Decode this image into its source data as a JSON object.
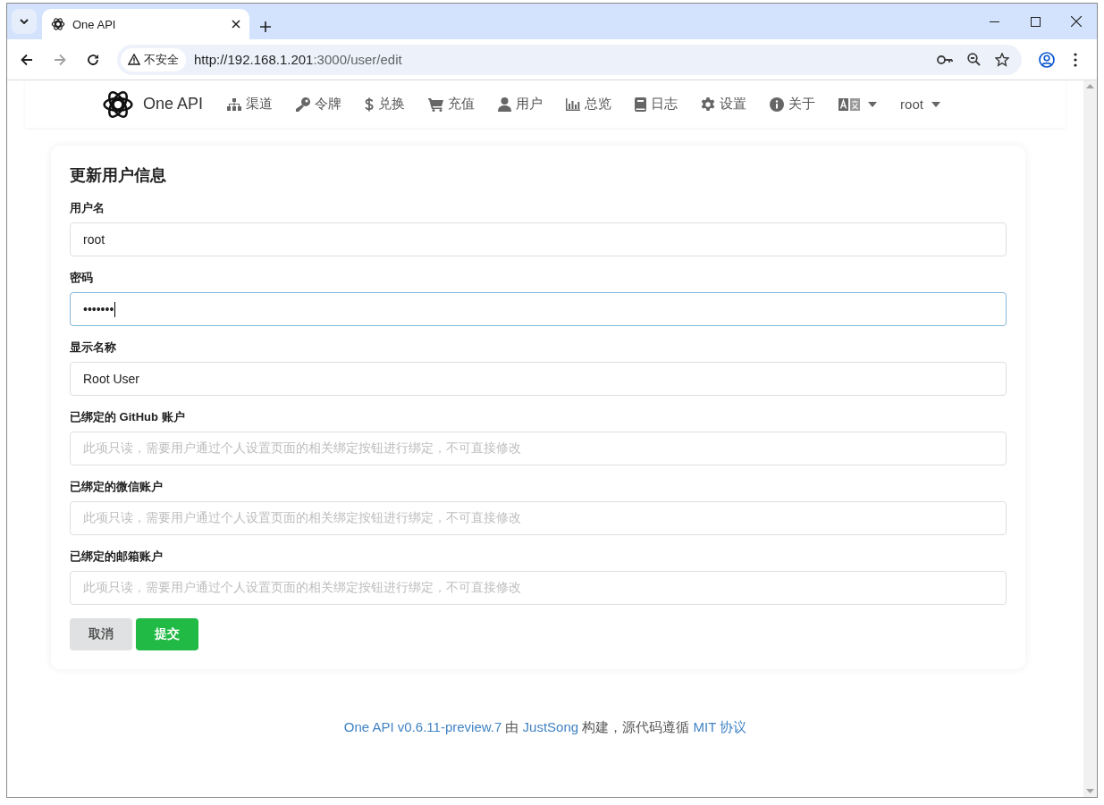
{
  "browser": {
    "tab": {
      "title": "One API"
    },
    "security_label": "不安全",
    "url": {
      "host": "http://192.168.1.201",
      "path": ":3000/user/edit"
    }
  },
  "nav": {
    "brand": "One API",
    "items": [
      {
        "label": "渠道",
        "kind": "sitemap"
      },
      {
        "label": "令牌",
        "kind": "key"
      },
      {
        "label": "兑换",
        "kind": "dollar"
      },
      {
        "label": "充值",
        "kind": "cart"
      },
      {
        "label": "用户",
        "kind": "user"
      },
      {
        "label": "总览",
        "kind": "chart"
      },
      {
        "label": "日志",
        "kind": "book"
      },
      {
        "label": "设置",
        "kind": "gear"
      },
      {
        "label": "关于",
        "kind": "info"
      }
    ],
    "user": "root"
  },
  "form": {
    "title": "更新用户信息",
    "fields": [
      {
        "label": "用户名",
        "value": "root",
        "focused": false
      },
      {
        "label": "密码",
        "value": "•••••••",
        "focused": true
      },
      {
        "label": "显示名称",
        "value": "Root User",
        "focused": false
      },
      {
        "label": "已绑定的 GitHub 账户",
        "placeholder": "此项只读，需要用户通过个人设置页面的相关绑定按钮进行绑定，不可直接修改",
        "focused": false
      },
      {
        "label": "已绑定的微信账户",
        "placeholder": "此项只读，需要用户通过个人设置页面的相关绑定按钮进行绑定，不可直接修改",
        "focused": false
      },
      {
        "label": "已绑定的邮箱账户",
        "placeholder": "此项只读，需要用户通过个人设置页面的相关绑定按钮进行绑定，不可直接修改",
        "focused": false
      }
    ],
    "buttons": [
      {
        "label": "取消",
        "kind": "secondary"
      },
      {
        "label": "提交",
        "kind": "primary"
      }
    ]
  },
  "footer": {
    "parts": [
      {
        "text": "One API v0.6.11-preview.7",
        "kind": "link"
      },
      {
        "text": " 由 ",
        "kind": "text"
      },
      {
        "text": "JustSong",
        "kind": "link"
      },
      {
        "text": " 构建，源代码遵循 ",
        "kind": "text"
      },
      {
        "text": "MIT 协议",
        "kind": "link"
      }
    ]
  }
}
